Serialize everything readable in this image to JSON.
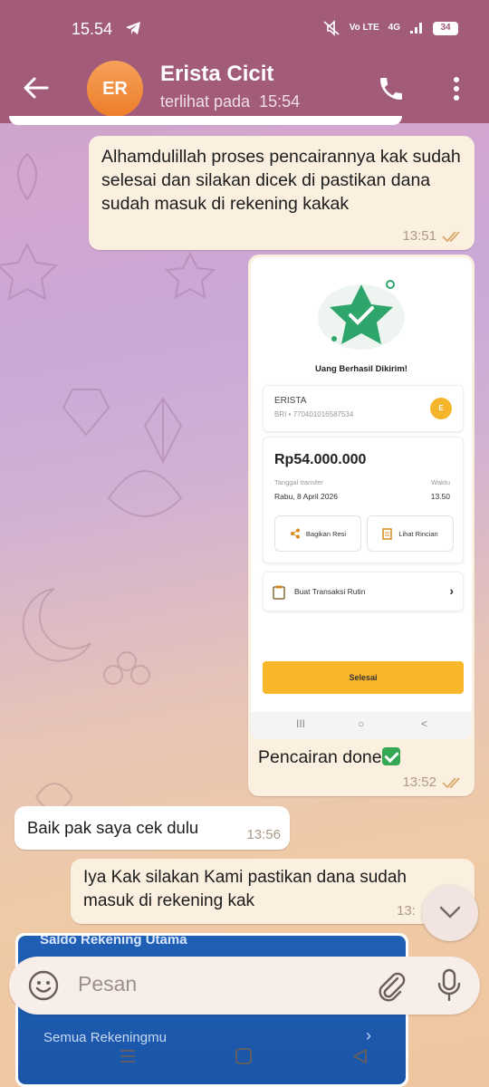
{
  "status_bar": {
    "time": "15.54",
    "net1": "Vo LTE",
    "net2": "4G",
    "battery": "34"
  },
  "header": {
    "avatar_initials": "ER",
    "contact_name": "Erista Cicit",
    "last_seen_label": "terlihat pada",
    "last_seen_time": "15:54"
  },
  "messages": {
    "m1": {
      "text": "Alhamdulillah proses pencairannya kak sudah selesai dan silakan dicek di pastikan dana sudah masuk di rekening kakak",
      "time": "13:51"
    },
    "m2": {
      "caption": "Pencairan done",
      "time": "13:52",
      "screenshot": {
        "title": "Uang Berhasil Dikirim!",
        "recipient_name": "ERISTA",
        "recipient_account": "BRI • 770401016587534",
        "recipient_initial": "E",
        "amount": "Rp54.000.000",
        "date_label": "Tanggal transfer",
        "date_value": "Rabu, 8 April 2026",
        "time_label": "Waktu",
        "time_value": "13.50",
        "share_label": "Bagikan Resi",
        "details_label": "Lihat Rincian",
        "routine_label": "Buat Transaksi Rutin",
        "done_label": "Selesai",
        "nav": [
          "III",
          "○",
          "<"
        ]
      }
    },
    "m3": {
      "text": "Baik pak saya cek dulu",
      "time": "13:56"
    },
    "m4": {
      "text": "Iya Kak silakan Kami pastikan dana sudah masuk di rekening kak",
      "time": "13:"
    },
    "m5": {
      "line1": "Saldo Rekening Utama",
      "line2": "Semua Rekeningmu",
      "arrow": "›"
    }
  },
  "input": {
    "placeholder": "Pesan"
  },
  "colors": {
    "header": "#a25c7a",
    "outgoing": "#fbefe0",
    "incoming": "#ffffff",
    "accent": "#f8b62a"
  }
}
